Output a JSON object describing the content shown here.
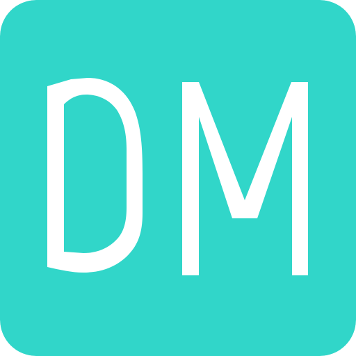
{
  "app_icon": {
    "logo_text": "DM",
    "colors": {
      "background": "#31d6c9",
      "foreground": "#ffffff"
    }
  }
}
